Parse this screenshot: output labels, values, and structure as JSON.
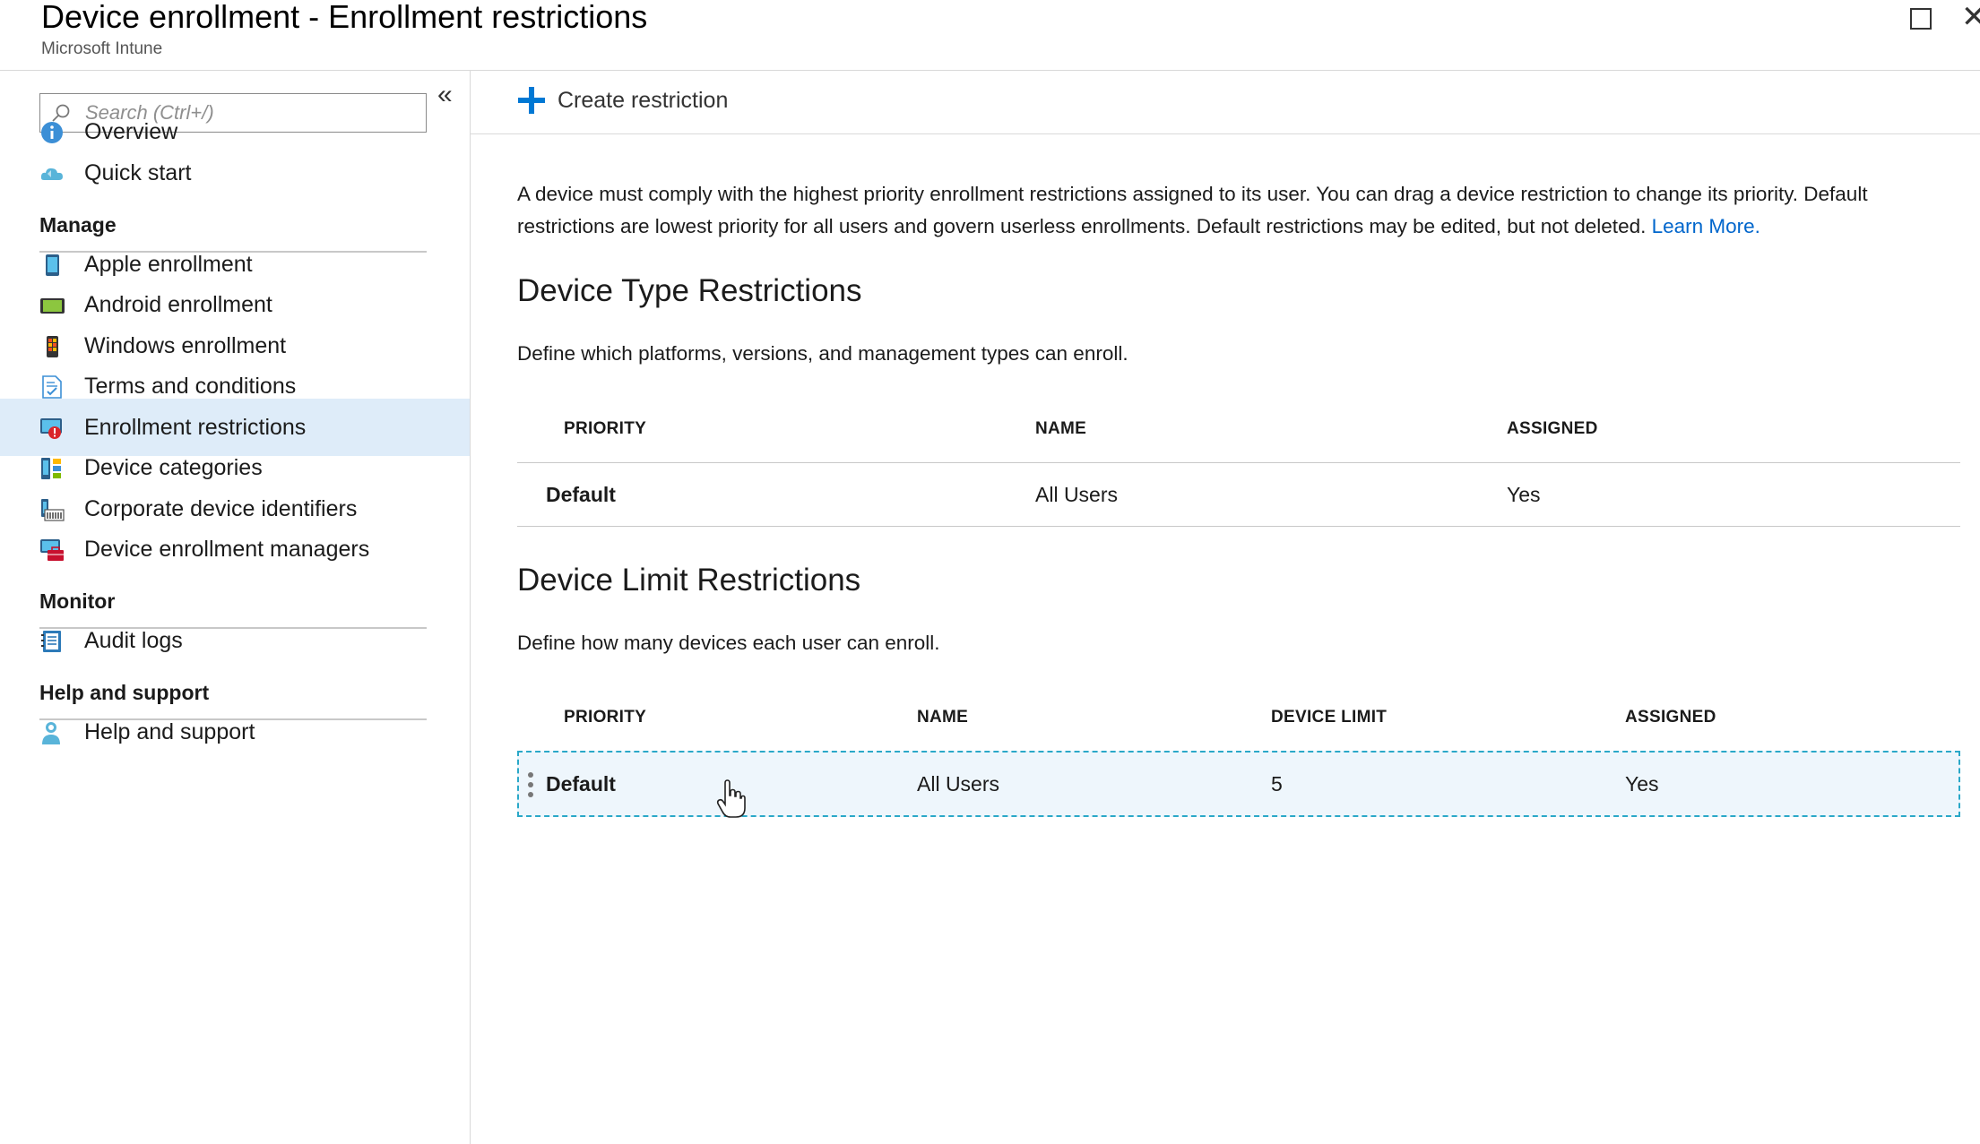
{
  "window": {
    "title": "Device enrollment - Enrollment restrictions",
    "subtitle": "Microsoft Intune"
  },
  "sidebar": {
    "search_placeholder": "Search (Ctrl+/)",
    "items": [
      {
        "label": "Overview",
        "icon": "info-icon"
      },
      {
        "label": "Quick start",
        "icon": "cloud-icon"
      }
    ],
    "sections": [
      {
        "heading": "Manage",
        "items": [
          {
            "label": "Apple enrollment",
            "icon": "ios-device-icon"
          },
          {
            "label": "Android enrollment",
            "icon": "android-device-icon"
          },
          {
            "label": "Windows enrollment",
            "icon": "windows-device-icon"
          },
          {
            "label": "Terms and conditions",
            "icon": "document-check-icon"
          },
          {
            "label": "Enrollment restrictions",
            "icon": "restriction-icon",
            "active": true
          },
          {
            "label": "Device categories",
            "icon": "categories-icon"
          },
          {
            "label": "Corporate device identifiers",
            "icon": "identifiers-icon"
          },
          {
            "label": "Device enrollment managers",
            "icon": "managers-icon"
          }
        ]
      },
      {
        "heading": "Monitor",
        "items": [
          {
            "label": "Audit logs",
            "icon": "audit-log-icon"
          }
        ]
      },
      {
        "heading": "Help and support",
        "items": [
          {
            "label": "Help and support",
            "icon": "help-person-icon"
          }
        ]
      }
    ]
  },
  "toolbar": {
    "create_label": "Create restriction"
  },
  "main": {
    "description_text": "A device must comply with the highest priority enrollment restrictions assigned to its user. You can drag a device restriction to change its priority. Default restrictions are lowest priority for all users and govern userless enrollments. Default restrictions may be edited, but not deleted.",
    "learn_more": "Learn More.",
    "device_type": {
      "heading": "Device Type Restrictions",
      "subheading": "Define which platforms, versions, and management types can enroll.",
      "columns": [
        "PRIORITY",
        "NAME",
        "ASSIGNED"
      ],
      "rows": [
        {
          "priority": "Default",
          "name": "All Users",
          "assigned": "Yes"
        }
      ]
    },
    "device_limit": {
      "heading": "Device Limit Restrictions",
      "subheading": "Define how many devices each user can enroll.",
      "columns": [
        "PRIORITY",
        "NAME",
        "DEVICE LIMIT",
        "ASSIGNED"
      ],
      "rows": [
        {
          "priority": "Default",
          "name": "All Users",
          "device_limit": "5",
          "assigned": "Yes"
        }
      ]
    }
  },
  "colors": {
    "accent": "#0078d4",
    "link": "#0066cc",
    "active_nav": "#deecf9",
    "selected_row_border": "#2aa8c8"
  }
}
